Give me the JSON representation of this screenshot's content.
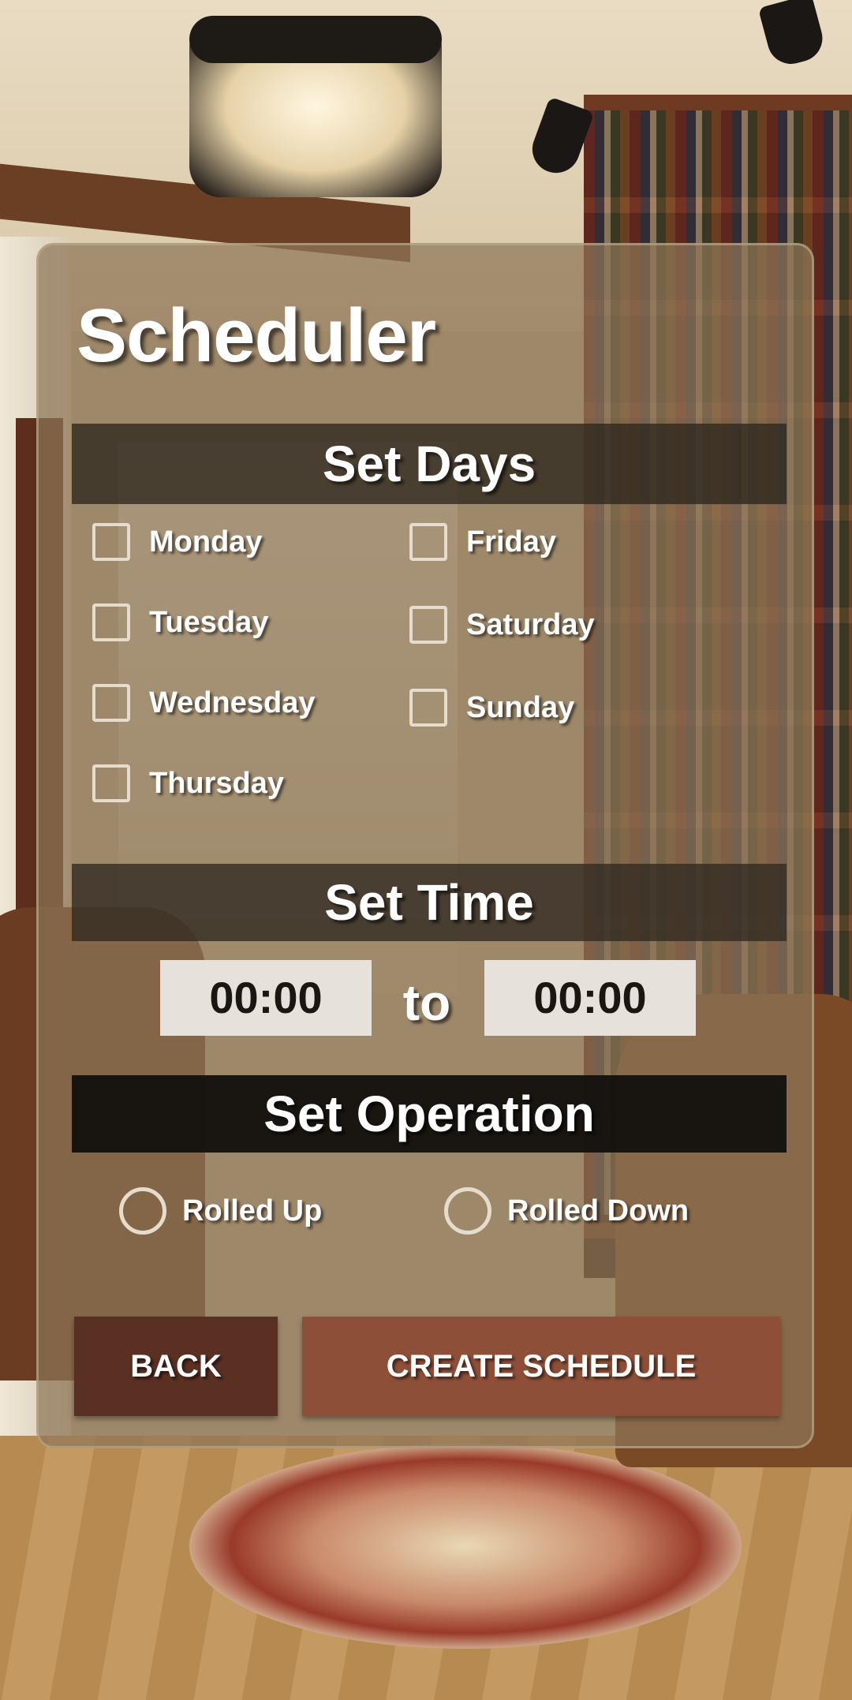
{
  "scheduler": {
    "title": "Scheduler",
    "days_header": "Set Days",
    "days": [
      {
        "label": "Monday",
        "checked": false
      },
      {
        "label": "Tuesday",
        "checked": false
      },
      {
        "label": "Wednesday",
        "checked": false
      },
      {
        "label": "Thursday",
        "checked": false
      },
      {
        "label": "Friday",
        "checked": false
      },
      {
        "label": "Saturday",
        "checked": false
      },
      {
        "label": "Sunday",
        "checked": false
      }
    ],
    "time_header": "Set Time",
    "start_time": "00:00",
    "separator": "to",
    "end_time": "00:00",
    "operation_header": "Set Operation",
    "operations": [
      {
        "label": "Rolled Up",
        "selected": false
      },
      {
        "label": "Rolled Down",
        "selected": false
      }
    ],
    "back_label": "BACK",
    "create_label": "CREATE SCHEDULE"
  },
  "colors": {
    "panel": "#8e7658",
    "back_button": "#5a3022",
    "create_button": "#8d4f37",
    "time_box": "#e6e1da"
  }
}
